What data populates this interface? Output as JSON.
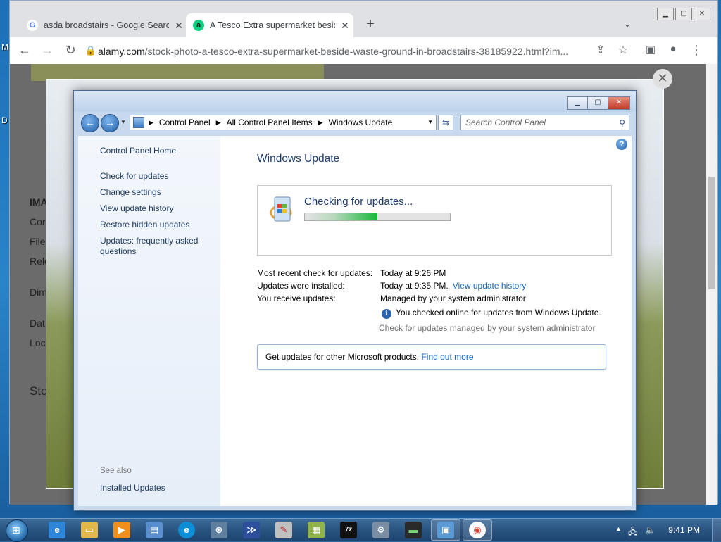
{
  "desktop": {
    "labels": [
      "M",
      "D"
    ]
  },
  "chrome": {
    "tabs": [
      {
        "title": "asda broadstairs - Google Search",
        "favicon": "G",
        "close": "✕"
      },
      {
        "title": "A Tesco Extra supermarket beside",
        "favicon": "a",
        "close": "✕"
      }
    ],
    "new_tab": "+",
    "tab_menu": "⌄",
    "url_host": "alamy.com",
    "url_path": "/stock-photo-a-tesco-extra-supermarket-beside-waste-ground-in-broadstairs-38185922.html?im...",
    "page_bits": {
      "ima": "IMA",
      "cor": "Cor",
      "file": "File",
      "rele": "Rele",
      "dim": "Dim",
      "dat": "Dat",
      "loc": "Loc",
      "sto": "Sto"
    }
  },
  "overlay_close": "✕",
  "cp": {
    "breadcrumbs": [
      "Control Panel",
      "All Control Panel Items",
      "Windows Update"
    ],
    "search_placeholder": "Search Control Panel",
    "sidebar": {
      "home": "Control Panel Home",
      "links": [
        "Check for updates",
        "Change settings",
        "View update history",
        "Restore hidden updates",
        "Updates: frequently asked",
        "questions"
      ],
      "see_also": "See also",
      "installed": "Installed Updates"
    },
    "title": "Windows Update",
    "status": "Checking for updates...",
    "progress": 0.5,
    "info": {
      "recent_label": "Most recent check for updates:",
      "recent_value": "Today at 9:26 PM",
      "installed_label": "Updates were installed:",
      "installed_value": "Today at 9:35 PM.",
      "installed_link": "View update history",
      "receive_label": "You receive updates:",
      "receive_value": "Managed by your system administrator",
      "checked_note": "You checked online for updates from Windows Update.",
      "managed_note": "Check for updates managed by your system administrator"
    },
    "get_updates": "Get updates for other Microsoft products.",
    "find_out_more": "Find out more"
  },
  "taskbar": {
    "clock": "9:41 PM",
    "apps": [
      "ie",
      "explorer",
      "media",
      "notepad-blue",
      "edge",
      "network",
      "powershell",
      "paint",
      "doc",
      "7z",
      "settings",
      "terminal",
      "control-panel",
      "chrome"
    ]
  }
}
